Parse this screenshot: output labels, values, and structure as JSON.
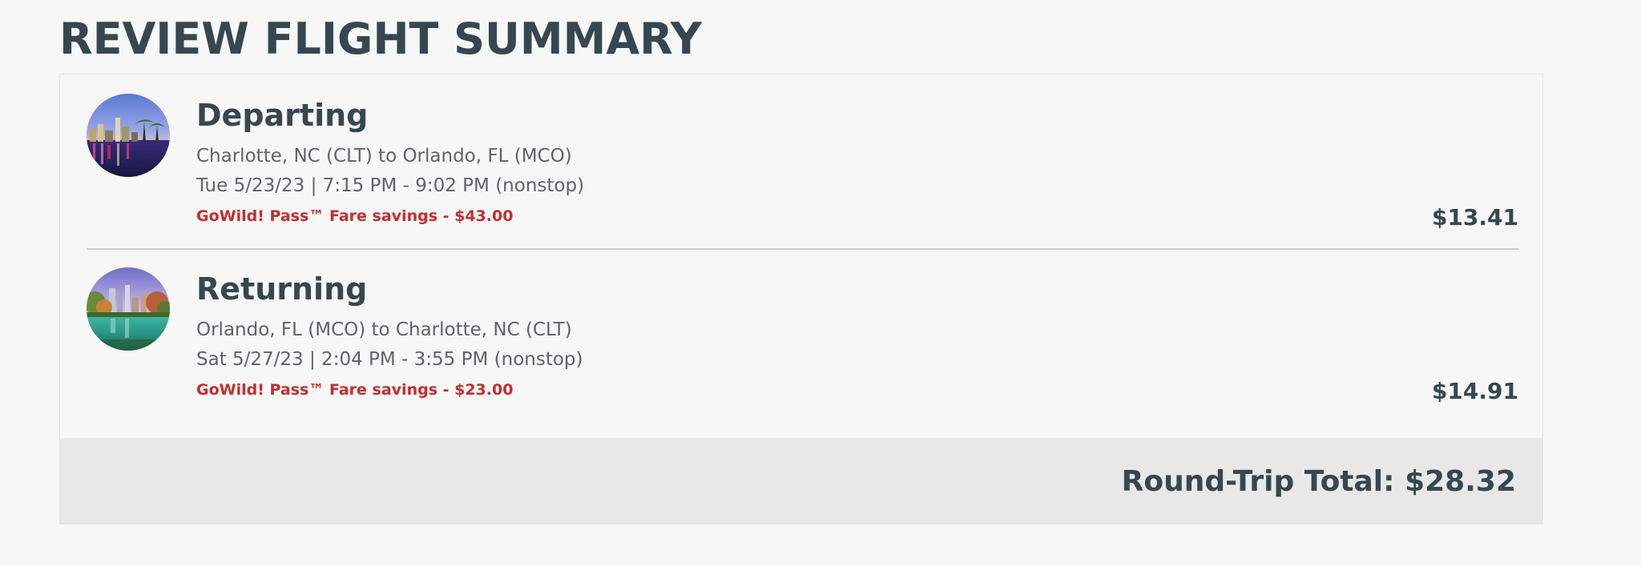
{
  "page": {
    "title": "REVIEW FLIGHT SUMMARY"
  },
  "flights": [
    {
      "title": "Departing",
      "route": "Charlotte, NC (CLT) to Orlando, FL (MCO)",
      "schedule": "Tue 5/23/23 | 7:15 PM - 9:02 PM (nonstop)",
      "savings": "GoWild! Pass™ Fare savings - $43.00",
      "price": "$13.41",
      "photo_icon": "orlando-skyline-night-photo"
    },
    {
      "title": "Returning",
      "route": "Orlando, FL (MCO) to Charlotte, NC (CLT)",
      "schedule": "Sat 5/27/23 | 2:04 PM - 3:55 PM (nonstop)",
      "savings": "GoWild! Pass™ Fare savings - $23.00",
      "price": "$14.91",
      "photo_icon": "charlotte-skyline-day-photo"
    }
  ],
  "total": {
    "label": "Round-Trip Total: $28.32"
  },
  "colors": {
    "heading": "#37474f",
    "body_text": "#5f6368",
    "savings": "#c62d2d",
    "background": "#f7f7f7",
    "total_bar": "#e8e8e8"
  }
}
